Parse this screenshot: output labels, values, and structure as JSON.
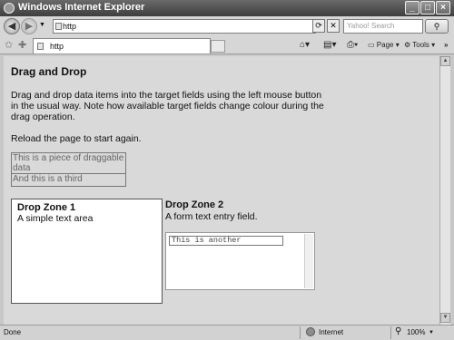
{
  "window": {
    "title": "Windows Internet Explorer"
  },
  "titlebar_buttons": [
    "_",
    "□",
    "×"
  ],
  "address_bar": {
    "value": "http",
    "search_placeholder": "Yahoo! Search"
  },
  "tab": {
    "label": "http"
  },
  "commands": {
    "page": "Page",
    "tools": "Tools"
  },
  "page": {
    "heading": "Drag and Drop",
    "intro": "Drag and drop data items into the target fields using the left mouse button in the usual way. Note how available target fields change colour during the drag operation.",
    "reload": "Reload the page to start again.",
    "drag_items": [
      "This is a piece of draggable data",
      "And this is a third"
    ],
    "zone1": {
      "title": "Drop Zone 1",
      "description": "A simple text area"
    },
    "zone2": {
      "title": "Drop Zone 2",
      "description": "A form text entry field.",
      "input_value": "This is another"
    }
  },
  "statusbar": {
    "status": "Done",
    "zone": "Internet",
    "zoom": "100%"
  }
}
